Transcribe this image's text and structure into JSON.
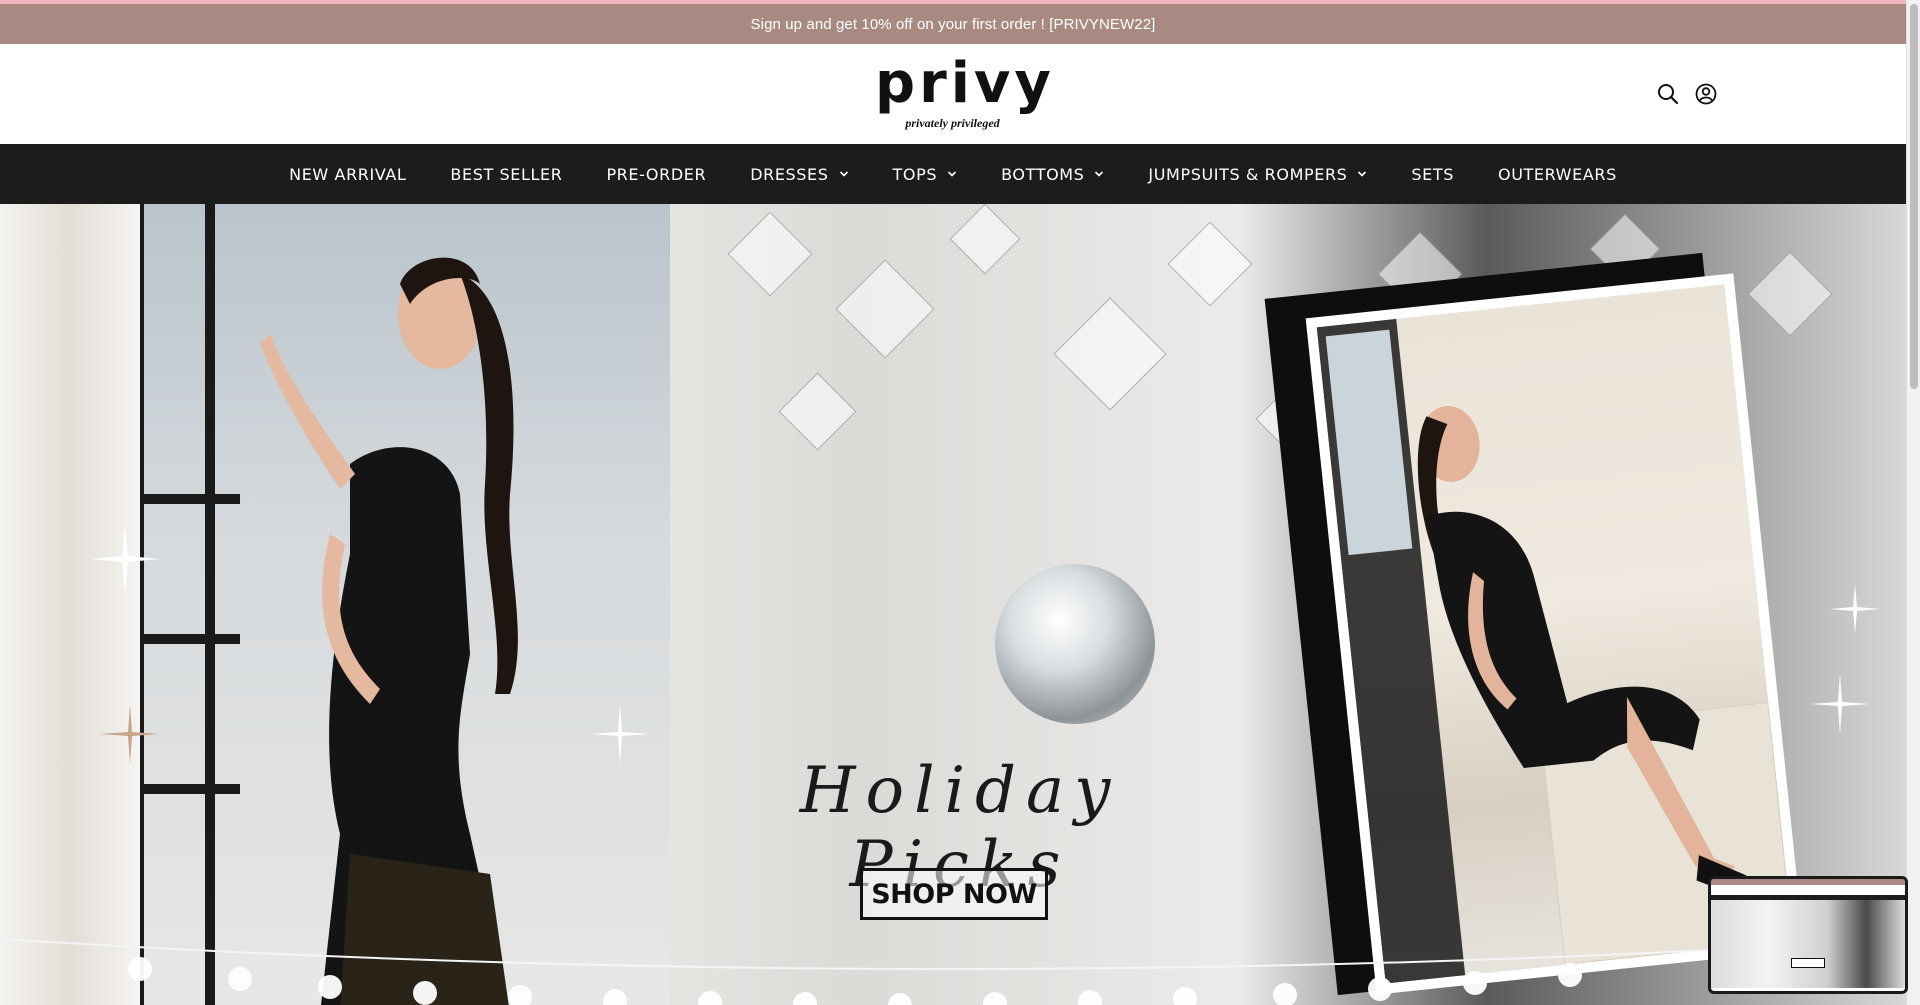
{
  "announcement": {
    "text": "Sign up and get 10% off on your first order ! [PRIVYNEW22]"
  },
  "header": {
    "logo_text": "privy",
    "tagline": "privately privileged",
    "icons": [
      "search-icon",
      "account-icon"
    ]
  },
  "nav": {
    "items": [
      {
        "label": "NEW ARRIVAL",
        "has_dropdown": false
      },
      {
        "label": "BEST SELLER",
        "has_dropdown": false
      },
      {
        "label": "PRE-ORDER",
        "has_dropdown": false
      },
      {
        "label": "DRESSES",
        "has_dropdown": true
      },
      {
        "label": "TOPS",
        "has_dropdown": true
      },
      {
        "label": "BOTTOMS",
        "has_dropdown": true
      },
      {
        "label": "JUMPSUITS & ROMPERS",
        "has_dropdown": true
      },
      {
        "label": "SETS",
        "has_dropdown": false
      },
      {
        "label": "OUTERWEARS",
        "has_dropdown": false
      }
    ]
  },
  "hero": {
    "title": "Holiday Picks",
    "cta_label": "SHOP NOW"
  },
  "colors": {
    "announcement_bg": "#a88a82",
    "nav_bg": "#1c1c1c",
    "accent_pink": "#f2b6c1"
  }
}
